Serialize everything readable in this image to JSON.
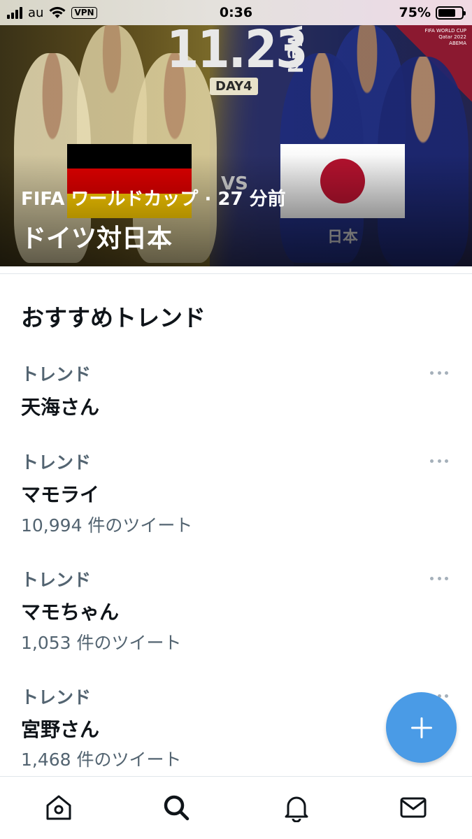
{
  "status_bar": {
    "carrier": "au",
    "vpn": "VPN",
    "time": "0:36",
    "battery_percent_text": "75%",
    "battery_level": 0.75
  },
  "hero": {
    "date": "11.23",
    "weekday": "Wed",
    "day_badge": "DAY4",
    "vs": "VS",
    "team_label": "日本",
    "logo_text_1": "FIFA WORLD CUP",
    "logo_text_2": "Qatar 2022",
    "logo_text_3": "ABEMA",
    "meta": "FIFA ワールドカップ · 27 分前",
    "title": "ドイツ対日本",
    "flag_colors": {
      "de": [
        "#000000",
        "#dd0000",
        "#ffce00"
      ],
      "jp_sun": "#b3122e"
    }
  },
  "section": {
    "title": "おすすめトレンド"
  },
  "trends": [
    {
      "category": "トレンド",
      "name": "天海さん",
      "count": ""
    },
    {
      "category": "トレンド",
      "name": "マモライ",
      "count": "10,994 件のツイート"
    },
    {
      "category": "トレンド",
      "name": "マモちゃん",
      "count": "1,053 件のツイート"
    },
    {
      "category": "トレンド",
      "name": "宮野さん",
      "count": "1,468 件のツイート"
    }
  ],
  "fab": {
    "icon": "plus-icon",
    "color": "#4a9be6"
  },
  "tabbar": {
    "items": [
      {
        "icon": "home-icon"
      },
      {
        "icon": "search-icon"
      },
      {
        "icon": "bell-icon"
      },
      {
        "icon": "mail-icon"
      }
    ]
  },
  "colors": {
    "accent": "#1d9bf0",
    "secondary_text": "#536471",
    "primary_text": "#0f1419"
  }
}
